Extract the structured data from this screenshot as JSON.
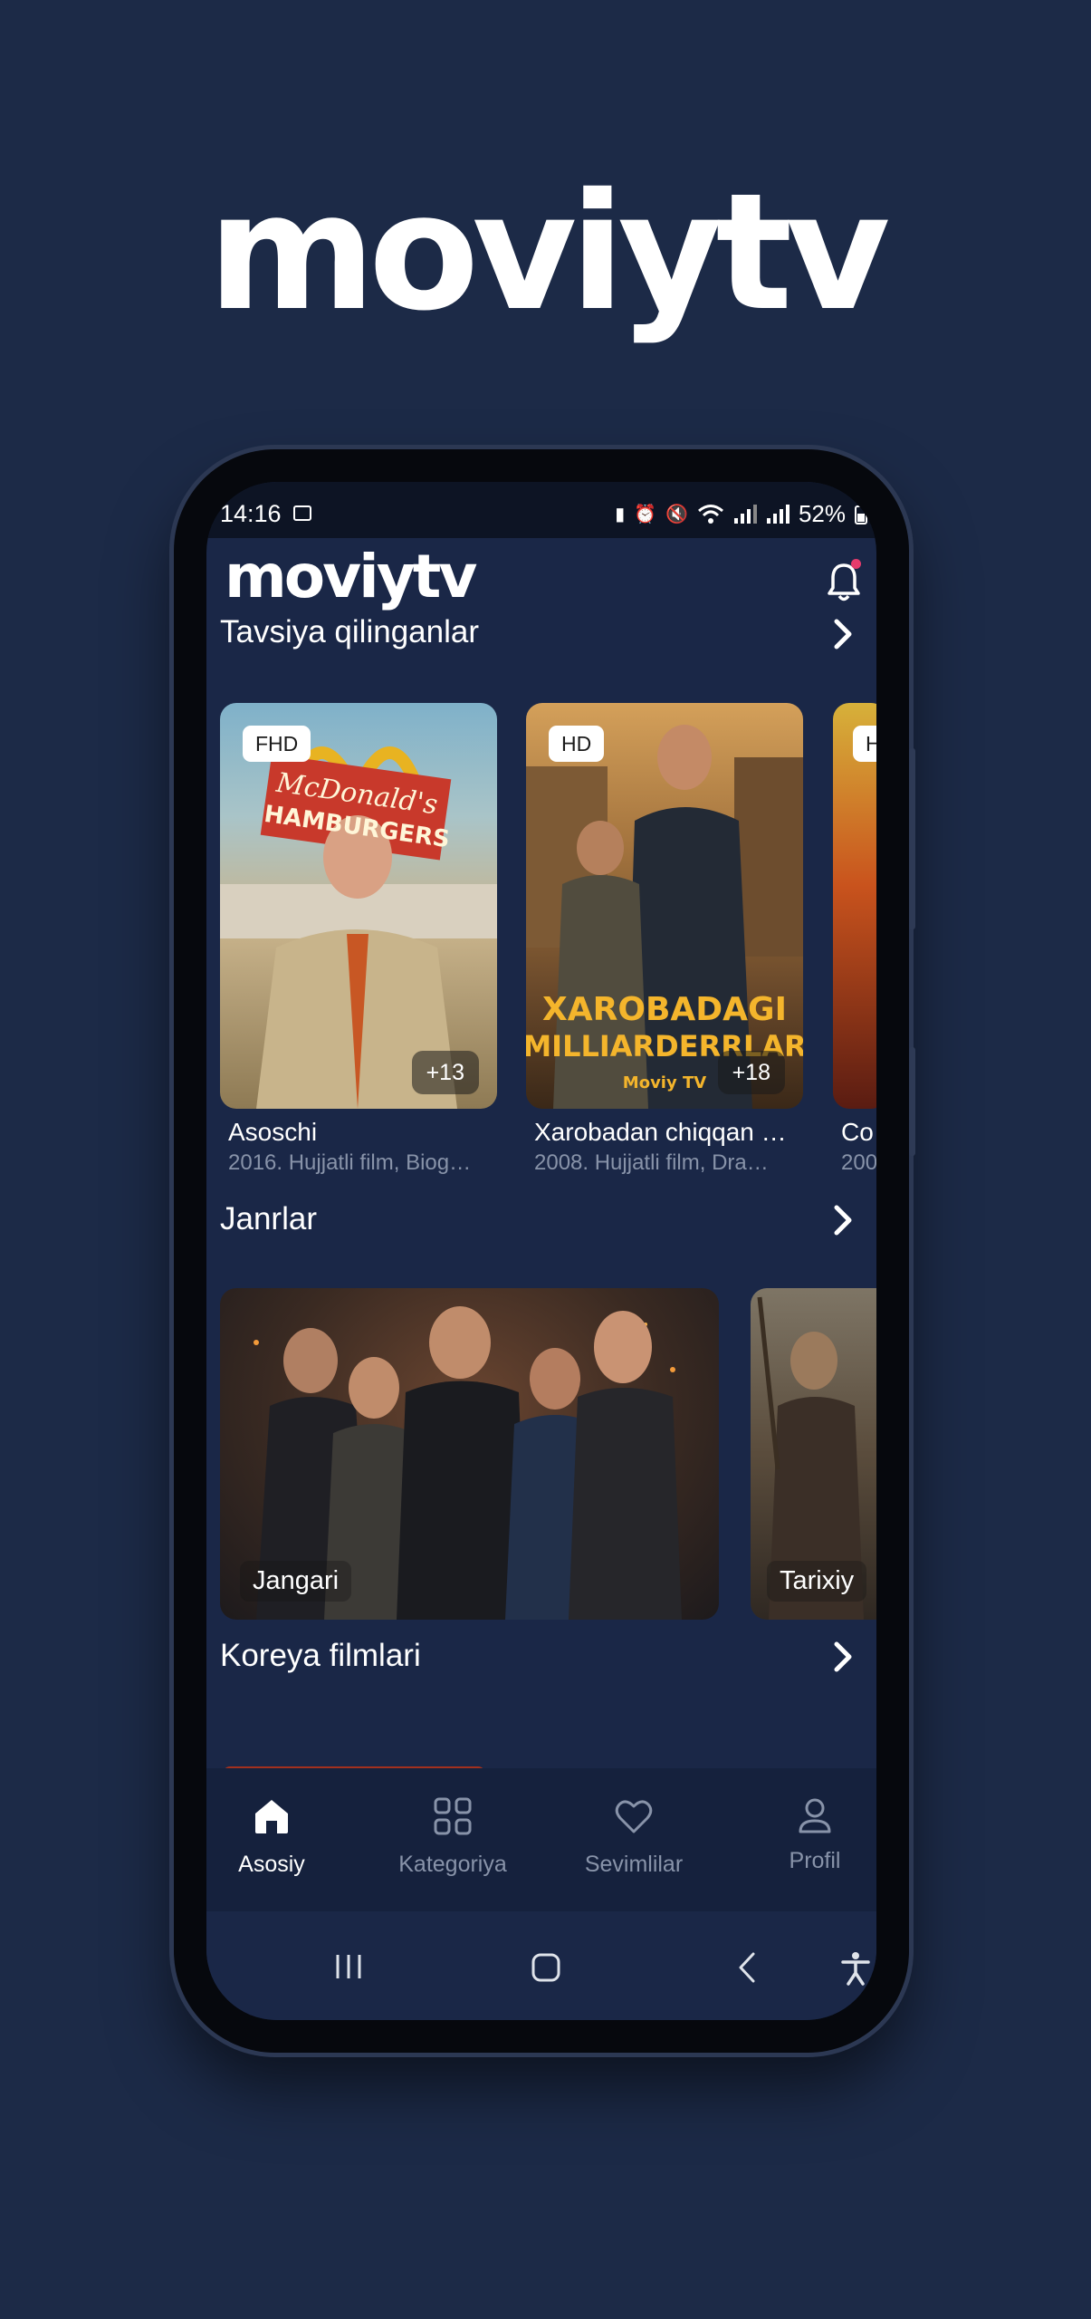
{
  "brand": {
    "logo_text": "moviytv"
  },
  "statusbar": {
    "time": "14:16",
    "battery": "52%"
  },
  "app": {
    "logo_text": "moviytv"
  },
  "sections": {
    "recommended": {
      "title": "Tavsiya qilinganlar"
    },
    "genres": {
      "title": "Janrlar"
    },
    "korean": {
      "title": "Koreya filmlari"
    }
  },
  "movies": [
    {
      "quality": "FHD",
      "age": "+13",
      "title": "Asoschi",
      "meta": "2016. Hujjatli film, Biog…",
      "poster_text": "McDonald's HAMBURGERS"
    },
    {
      "quality": "HD",
      "age": "+18",
      "title": "Xarobadan chiqqan …",
      "meta": "2008. Hujjatli film, Dra…",
      "poster_text_1": "XAROBADAGI",
      "poster_text_2": "MILLIARDERRLAR",
      "poster_brand": "Moviy TV"
    },
    {
      "quality": "H",
      "title": "Co",
      "meta": "200"
    }
  ],
  "genres": [
    {
      "label": "Jangari"
    },
    {
      "label": "Tarixiy"
    }
  ],
  "bottom_nav": [
    {
      "label": "Asosiy",
      "icon": "home-icon",
      "active": true
    },
    {
      "label": "Kategoriya",
      "icon": "grid-icon",
      "active": false
    },
    {
      "label": "Sevimlilar",
      "icon": "heart-icon",
      "active": false
    },
    {
      "label": "Profil",
      "icon": "user-icon",
      "active": false
    }
  ],
  "colors": {
    "background": "#1c2a47",
    "screen": "#1a2747",
    "accent_dot": "#e53b6c",
    "muted_text": "#8893a9"
  }
}
